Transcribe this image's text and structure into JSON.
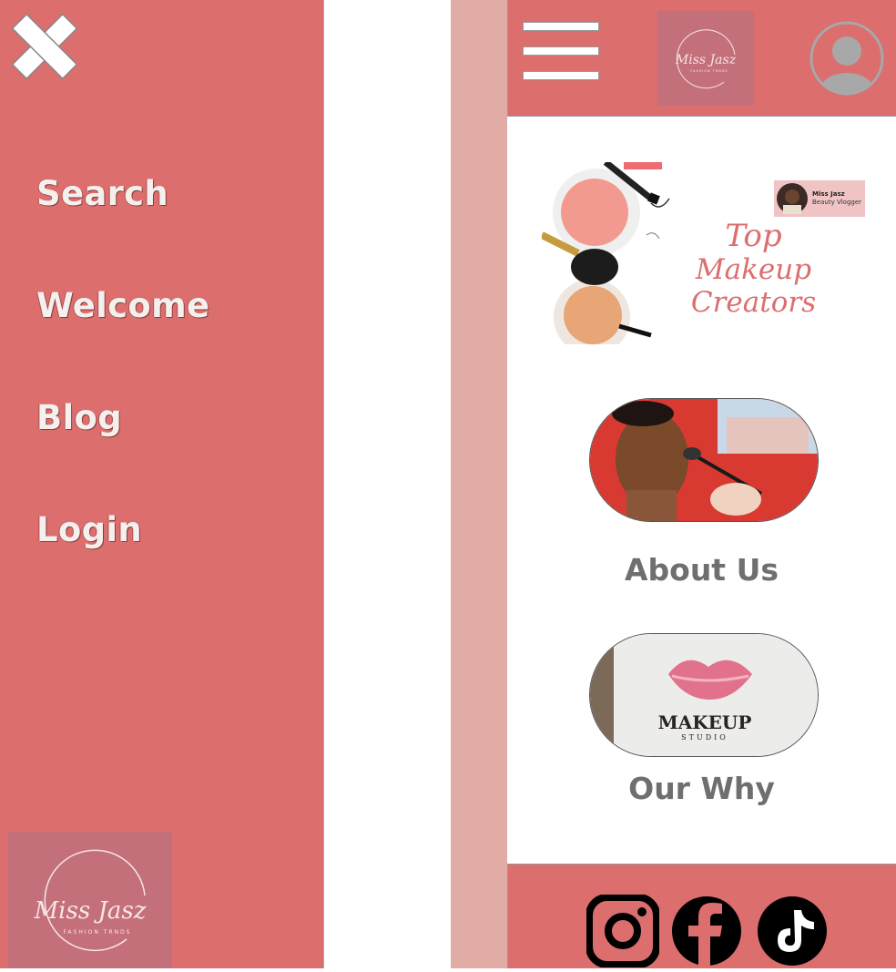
{
  "drawer": {
    "close_icon": "close-x-icon",
    "nav_items": [
      {
        "label": "Search"
      },
      {
        "label": "Welcome"
      },
      {
        "label": "Blog"
      },
      {
        "label": "Login"
      }
    ],
    "logo": {
      "line1": "Miss Jasz",
      "line2": "FASHION TRNDS"
    }
  },
  "topbar": {
    "menu_icon": "hamburger-icon",
    "logo": {
      "line1": "Miss Jasz",
      "line2": "FASHION TRNDS"
    },
    "profile_icon": "user-avatar-icon"
  },
  "banner": {
    "title_line1": "Top",
    "title_line2": "Makeup Creators",
    "badge_name": "Miss Jasz",
    "badge_role": "Beauty Vlogger"
  },
  "sections": {
    "about_label": "About Us",
    "why_label": "Our Why",
    "makeup_text": "MAKEUP",
    "studio_text": "STUDIO"
  },
  "footer": {
    "icons": [
      "instagram-icon",
      "facebook-icon",
      "tiktok-icon"
    ]
  },
  "colors": {
    "primary": "#dc6e6e",
    "side_strip": "#e0aca5",
    "logo_bg": "#c4707a",
    "label_gray": "#6f6f6f"
  }
}
